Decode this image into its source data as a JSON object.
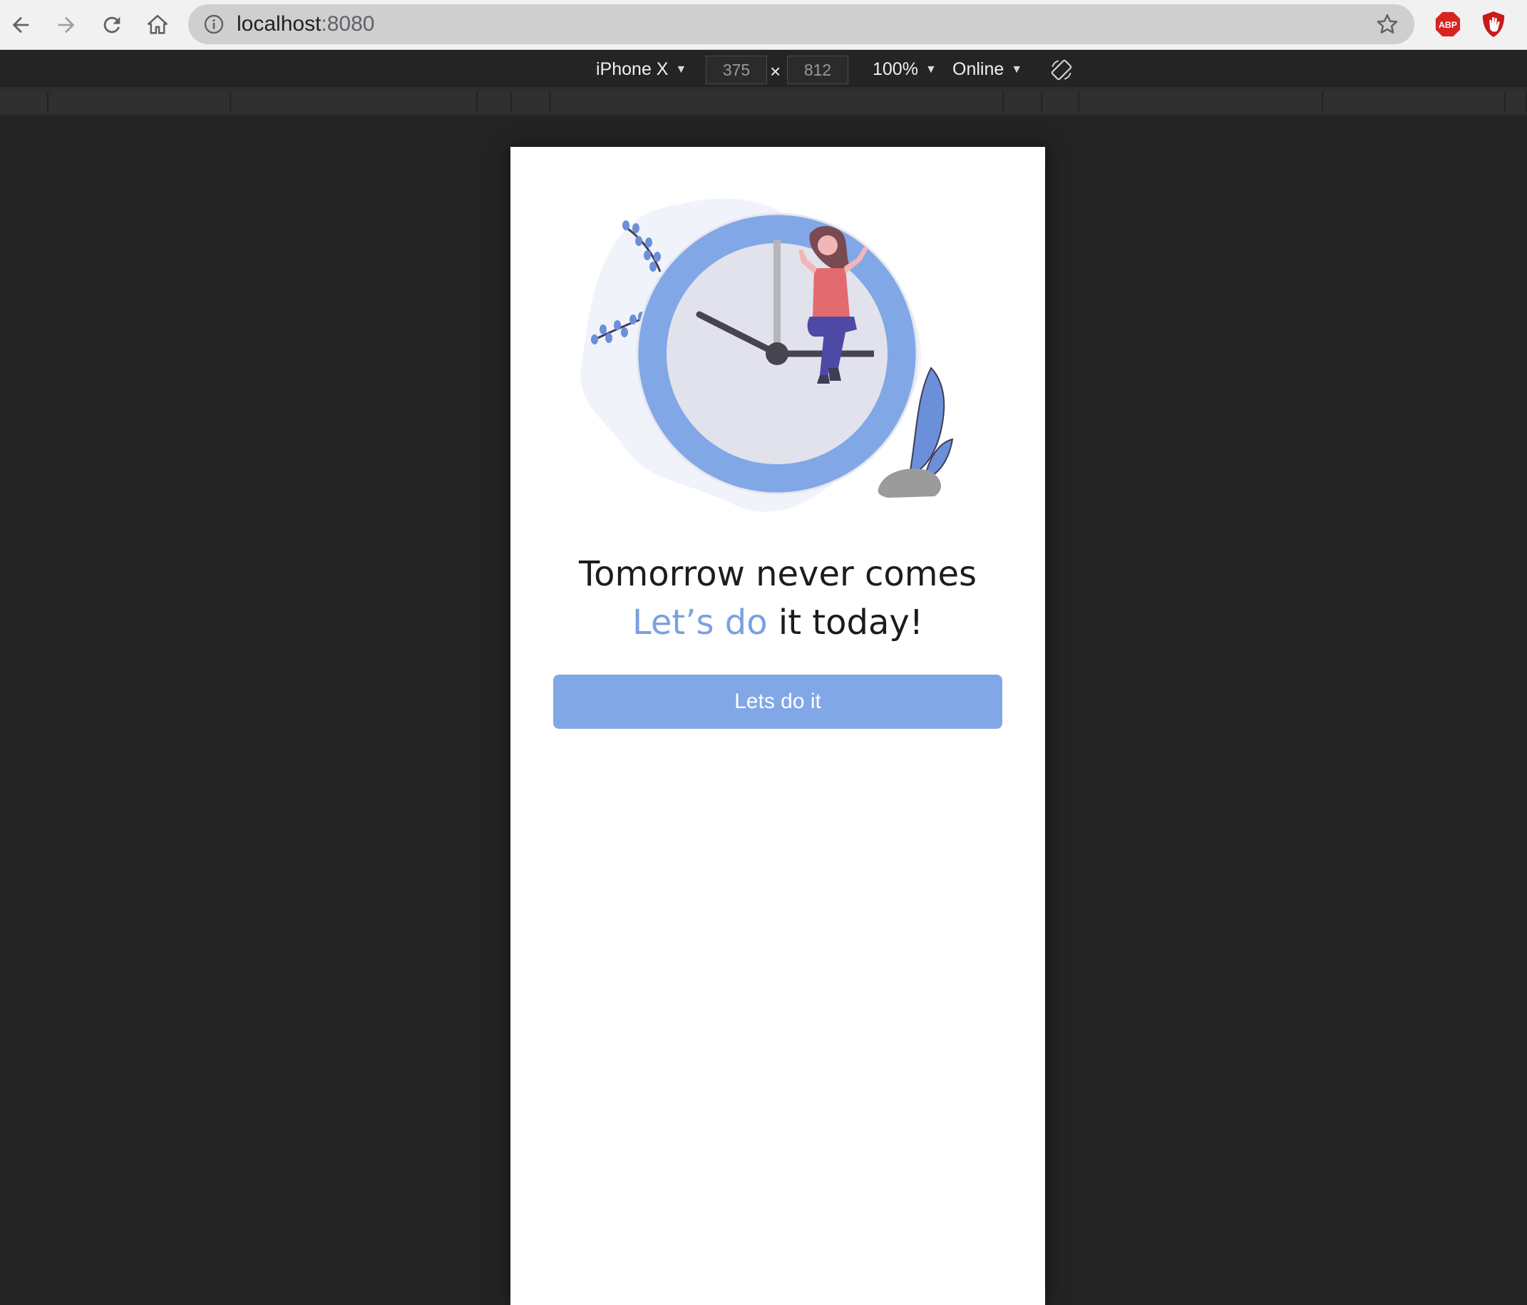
{
  "browser": {
    "url_host": "localhost",
    "url_port": ":8080",
    "icons": {
      "back": "arrow-left-icon",
      "forward": "arrow-right-icon",
      "reload": "reload-icon",
      "home": "home-icon",
      "info": "info-icon",
      "bookmark": "star-icon",
      "adblock": "abp-icon",
      "ublock": "ublock-hand-icon"
    },
    "extension_abp_label": "ABP"
  },
  "device_toolbar": {
    "device_name": "iPhone X",
    "width": "375",
    "height": "812",
    "dim_separator": "×",
    "zoom": "100%",
    "network": "Online"
  },
  "app": {
    "headline_line1": "Tomorrow never comes",
    "headline_accent": "Let’s do",
    "headline_rest": " it today!",
    "cta_label": "Lets do it",
    "accent_color": "#7aa0e2",
    "button_color": "#82a7e6"
  }
}
